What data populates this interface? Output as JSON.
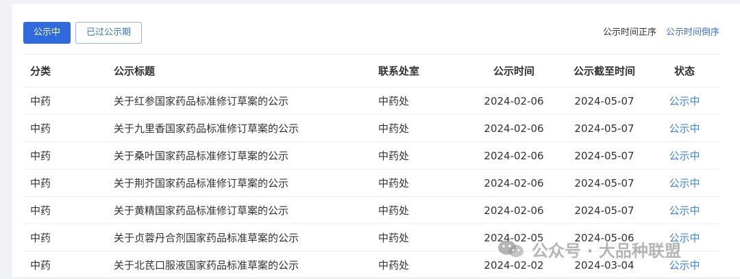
{
  "toolbar": {
    "active_tab": "公示中",
    "past_tab": "已过公示期",
    "sort_asc": "公示时间正序",
    "sort_desc": "公示时间倒序"
  },
  "table": {
    "headers": [
      "分类",
      "公示标题",
      "联系处室",
      "公示时间",
      "公示截至时间",
      "状态"
    ],
    "rows": [
      [
        "中药",
        "关于红参国家药品标准修订草案的公示",
        "中药处",
        "2024-02-06",
        "2024-05-07",
        "公示中"
      ],
      [
        "中药",
        "关于九里香国家药品标准修订草案的公示",
        "中药处",
        "2024-02-06",
        "2024-05-07",
        "公示中"
      ],
      [
        "中药",
        "关于桑叶国家药品标准修订草案的公示",
        "中药处",
        "2024-02-06",
        "2024-05-07",
        "公示中"
      ],
      [
        "中药",
        "关于荆芥国家药品标准修订草案的公示",
        "中药处",
        "2024-02-06",
        "2024-05-07",
        "公示中"
      ],
      [
        "中药",
        "关于黄精国家药品标准修订草案的公示",
        "中药处",
        "2024-02-06",
        "2024-05-07",
        "公示中"
      ],
      [
        "中药",
        "关于贞蓉丹合剂国家药品标准草案的公示",
        "中药处",
        "2024-02-05",
        "2024-05-06",
        "公示中"
      ],
      [
        "中药",
        "关于北芪口服液国家药品标准草案的公示",
        "中药处",
        "2024-02-02",
        "2024-03-04",
        "公示中"
      ]
    ]
  },
  "watermark": {
    "text": "公众号 · 大品种联盟",
    "icon": "wechat-icon"
  },
  "colors": {
    "primary": "#2f6bdc",
    "link": "#3a6fd8",
    "status": "#3a86d8",
    "border": "#ebeef5"
  }
}
